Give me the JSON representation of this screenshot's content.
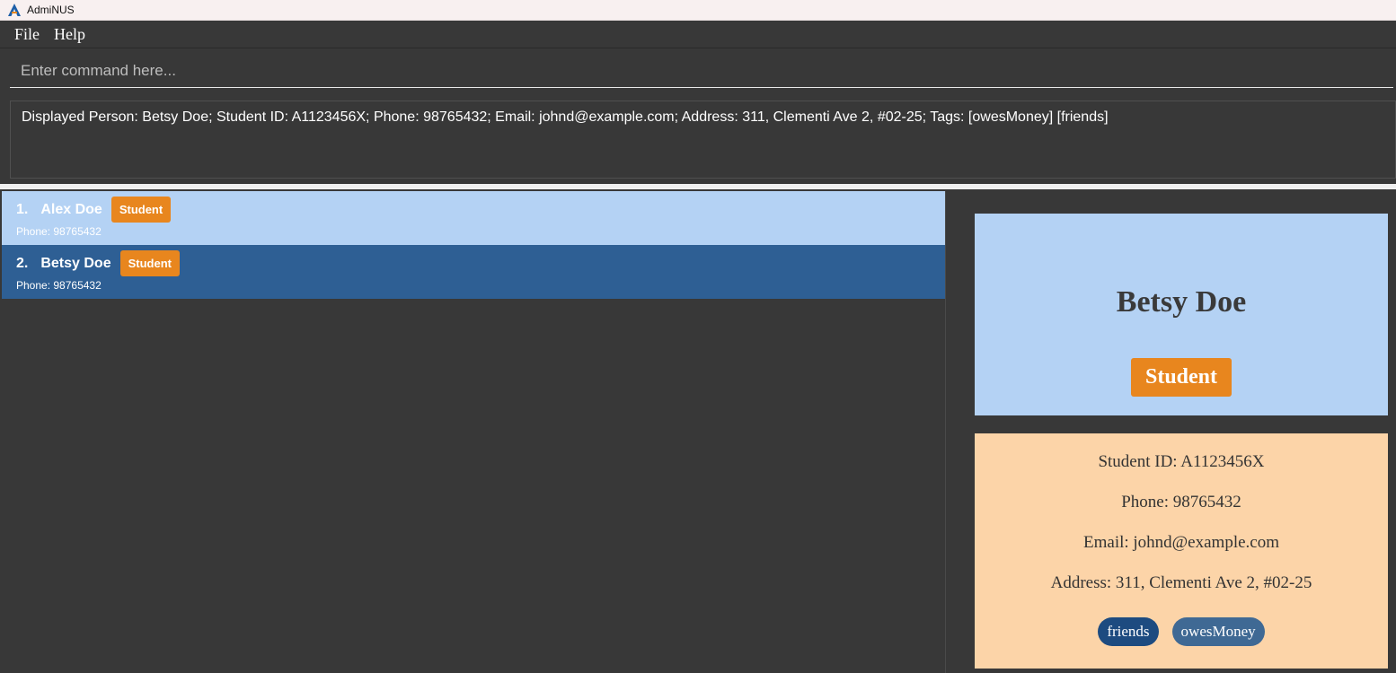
{
  "window": {
    "title": "AdmiNUS",
    "logo_icon": "adminus-logo-icon"
  },
  "menubar": {
    "items": [
      "File",
      "Help"
    ]
  },
  "command": {
    "placeholder": "Enter command here...",
    "value": ""
  },
  "result": {
    "text": "Displayed Person: Betsy Doe; Student ID: A1123456X; Phone: 98765432; Email: johnd@example.com; Address: 311, Clementi Ave 2, #02-25; Tags: [owesMoney] [friends]"
  },
  "person_list": [
    {
      "index": "1.",
      "name": "Alex Doe",
      "role": "Student",
      "phone": "Phone: 98765432",
      "selected": false
    },
    {
      "index": "2.",
      "name": "Betsy Doe",
      "role": "Student",
      "phone": "Phone: 98765432",
      "selected": true
    }
  ],
  "detail": {
    "name": "Betsy Doe",
    "role": "Student",
    "student_id": "Student ID: A1123456X",
    "phone": "Phone: 98765432",
    "email": "Email: johnd@example.com",
    "address": "Address: 311, Clementi Ave 2, #02-25",
    "tags": [
      "friends",
      "owesMoney"
    ]
  },
  "colors": {
    "background": "#383838",
    "selected_card": "#2e5f94",
    "unselected_card": "#b4d2f4",
    "role_badge": "#e8861e",
    "detail_header": "#b4d2f4",
    "detail_info": "#fcd4a8",
    "tag_primary": "#1d4b80",
    "tag_secondary": "#3f6994"
  }
}
